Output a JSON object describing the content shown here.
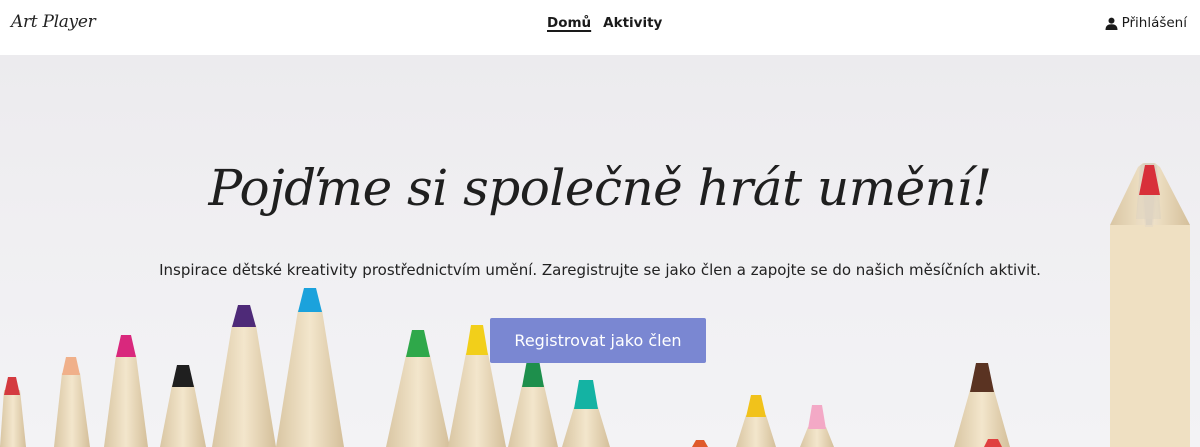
{
  "header": {
    "brand": "Art Player",
    "nav": [
      {
        "label": "Domů",
        "active": true
      },
      {
        "label": "Aktivity",
        "active": false
      }
    ],
    "login": {
      "label": "Přihlášení",
      "icon": "user-icon"
    }
  },
  "hero": {
    "title": "Pojďme si společně hrát umění!",
    "subtitle": "Inspirace dětské kreativity prostřednictvím umění. Zaregistrujte se jako člen a zapojte se do našich měsíčních aktivit.",
    "cta_label": "Registrovat jako člen"
  },
  "colors": {
    "accent": "#7a87d2",
    "text": "#1f1f1f",
    "background": "#f0eff2"
  }
}
